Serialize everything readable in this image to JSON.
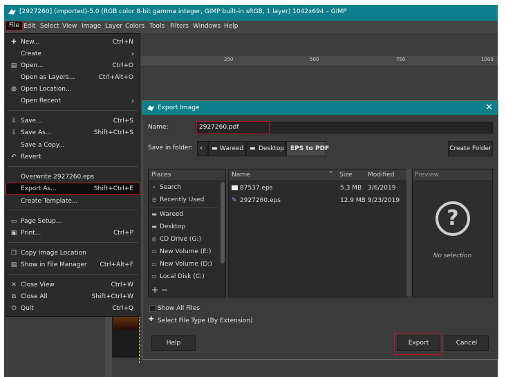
{
  "window": {
    "title": "[2927260] (imported)-5.0 (RGB color 8-bit gamma integer, GIMP built-in sRGB, 1 layer) 1042x694 – GIMP"
  },
  "menubar": [
    "File",
    "Edit",
    "Select",
    "View",
    "Image",
    "Layer",
    "Colors",
    "Tools",
    "Filters",
    "Windows",
    "Help"
  ],
  "ruler": {
    "marks": [
      "250",
      "500",
      "750",
      "1000"
    ]
  },
  "file_menu": {
    "items": [
      {
        "icon": "new-icon",
        "label": "New...",
        "shortcut": "Ctrl+N"
      },
      {
        "icon": "",
        "label": "Create",
        "shortcut": "",
        "submenu": true
      },
      {
        "icon": "open-icon",
        "label": "Open...",
        "shortcut": "Ctrl+O"
      },
      {
        "icon": "",
        "label": "Open as Layers...",
        "shortcut": "Ctrl+Alt+O"
      },
      {
        "icon": "globe-icon",
        "label": "Open Location...",
        "shortcut": ""
      },
      {
        "icon": "",
        "label": "Open Recent",
        "shortcut": "",
        "submenu": true
      },
      {
        "icon": "save-icon",
        "label": "Save...",
        "shortcut": "Ctrl+S"
      },
      {
        "icon": "",
        "label": "Save As...",
        "shortcut": "Shift+Ctrl+S"
      },
      {
        "icon": "",
        "label": "Save a Copy...",
        "shortcut": ""
      },
      {
        "icon": "revert-icon",
        "label": "Revert",
        "shortcut": ""
      },
      {
        "icon": "",
        "label": "Overwrite 2927260.eps",
        "shortcut": ""
      },
      {
        "icon": "",
        "label": "Export As...",
        "shortcut": "Shift+Ctrl+E"
      },
      {
        "icon": "",
        "label": "Create Template...",
        "shortcut": ""
      },
      {
        "icon": "page-setup-icon",
        "label": "Page Setup...",
        "shortcut": ""
      },
      {
        "icon": "print-icon",
        "label": "Print...",
        "shortcut": "Ctrl+P"
      },
      {
        "icon": "copy-icon",
        "label": "Copy Image Location",
        "shortcut": ""
      },
      {
        "icon": "folder-icon",
        "label": "Show in File Manager",
        "shortcut": "Ctrl+Alt+F"
      },
      {
        "icon": "close-icon",
        "label": "Close View",
        "shortcut": "Ctrl+W"
      },
      {
        "icon": "close-all-icon",
        "label": "Close All",
        "shortcut": "Shift+Ctrl+W"
      },
      {
        "icon": "quit-icon",
        "label": "Quit",
        "shortcut": "Ctrl+Q"
      }
    ]
  },
  "dialog": {
    "title": "Export Image",
    "name_label": "Name:",
    "name_value": "2927260.pdf",
    "save_in_label": "Save in folder:",
    "breadcrumbs": [
      "Wareed",
      "Desktop",
      "EPS to PDF"
    ],
    "create_folder": "Create Folder",
    "places_header": "Places",
    "places": [
      {
        "icon": "search-icon",
        "label": "Search"
      },
      {
        "icon": "recent-icon",
        "label": "Recently Used"
      },
      {
        "icon": "folder-icon",
        "label": "Wareed"
      },
      {
        "icon": "folder-icon",
        "label": "Desktop"
      },
      {
        "icon": "cd-icon",
        "label": "CD Drive (G:)"
      },
      {
        "icon": "drive-icon",
        "label": "New Volume (E:)"
      },
      {
        "icon": "drive-icon",
        "label": "New Volume (D:)"
      },
      {
        "icon": "drive-icon",
        "label": "Local Disk (C:)"
      }
    ],
    "columns": {
      "name": "Name",
      "size": "Size",
      "modified": "Modified"
    },
    "files": [
      {
        "name": "87537.eps",
        "size": "5.3 MB",
        "modified": "3/6/2019"
      },
      {
        "name": "2927260.eps",
        "size": "12.9 MB",
        "modified": "9/23/2019"
      }
    ],
    "preview_header": "Preview",
    "no_selection": "No selection",
    "show_all_files": "Show All Files",
    "select_file_type": "Select File Type (By Extension)",
    "help": "Help",
    "export": "Export",
    "cancel": "Cancel"
  }
}
